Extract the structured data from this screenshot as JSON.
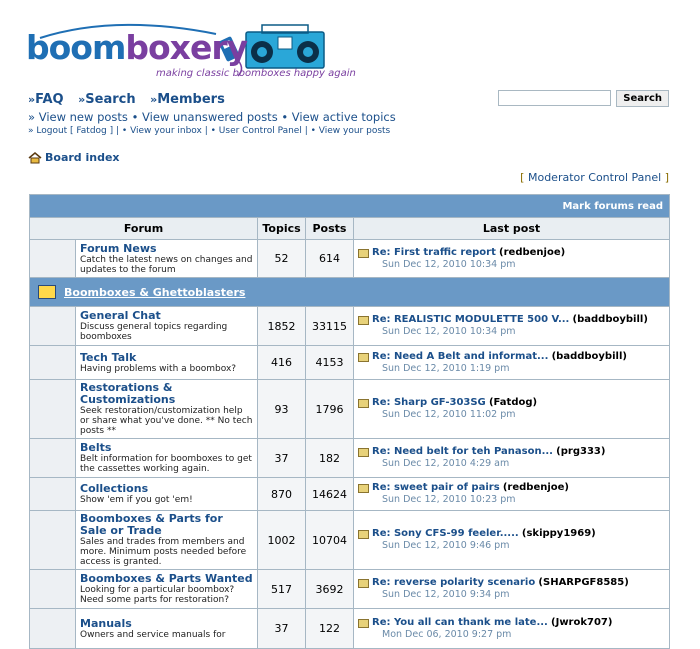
{
  "brand": {
    "name": "boomboxery",
    "tagline": "making classic boomboxes happy again",
    "colors": {
      "blue": "#1f6fb4",
      "purple": "#7a3fa0",
      "boombox": "#2aa7d8"
    }
  },
  "nav": {
    "faq": "FAQ",
    "search": "Search",
    "members": "Members"
  },
  "search": {
    "value": "",
    "button": "Search"
  },
  "subnav": {
    "new_posts": "View new posts",
    "unanswered": "View unanswered posts",
    "active": "View active topics"
  },
  "links": {
    "logout": "Logout [ Fatdog ]",
    "inbox": "View your inbox",
    "ucp": "User Control Panel",
    "your_posts": "View your posts"
  },
  "breadcrumb": {
    "label": "Board index"
  },
  "moderator": {
    "label": "Moderator Control Panel"
  },
  "table": {
    "mark_read": "Mark forums read",
    "headers": {
      "forum": "Forum",
      "topics": "Topics",
      "posts": "Posts",
      "last": "Last post"
    },
    "top_forum": {
      "name": "Forum News",
      "desc": "Catch the latest news on changes and updates to the forum",
      "topics": "52",
      "posts": "614",
      "last_title": "Re: First traffic report",
      "last_by": "(redbenjoe)",
      "last_date": "Sun Dec 12, 2010 10:34 pm"
    },
    "category": "Boomboxes & Ghettoblasters",
    "forums": [
      {
        "name": "General Chat",
        "desc": "Discuss general topics regarding boomboxes",
        "topics": "1852",
        "posts": "33115",
        "last_title": "Re: REALISTIC MODULETTE 500 V...",
        "last_by": "(baddboybill)",
        "last_date": "Sun Dec 12, 2010 10:34 pm"
      },
      {
        "name": "Tech Talk",
        "desc": "Having problems with a boombox?",
        "topics": "416",
        "posts": "4153",
        "last_title": "Re: Need A Belt and informat...",
        "last_by": "(baddboybill)",
        "last_date": "Sun Dec 12, 2010 1:19 pm"
      },
      {
        "name": "Restorations & Customizations",
        "desc": "Seek restoration/customization help or share what you've done. ** No tech posts **",
        "topics": "93",
        "posts": "1796",
        "last_title": "Re: Sharp GF-303SG",
        "last_by": "(Fatdog)",
        "last_date": "Sun Dec 12, 2010 11:02 pm"
      },
      {
        "name": "Belts",
        "desc": "Belt information for boomboxes to get the cassettes working again.",
        "topics": "37",
        "posts": "182",
        "last_title": "Re: Need belt for teh Panason...",
        "last_by": "(prg333)",
        "last_date": "Sun Dec 12, 2010 4:29 am"
      },
      {
        "name": "Collections",
        "desc": "Show 'em if you got 'em!",
        "topics": "870",
        "posts": "14624",
        "last_title": "Re: sweet pair of pairs",
        "last_by": "(redbenjoe)",
        "last_date": "Sun Dec 12, 2010 10:23 pm"
      },
      {
        "name": "Boomboxes & Parts for Sale or Trade",
        "desc": "Sales and trades from members and more. Minimum posts needed before access is granted.",
        "topics": "1002",
        "posts": "10704",
        "last_title": "Re: Sony CFS-99 feeler.....",
        "last_by": "(skippy1969)",
        "last_date": "Sun Dec 12, 2010 9:46 pm"
      },
      {
        "name": "Boomboxes & Parts Wanted",
        "desc": "Looking for a particular boombox? Need some parts for restoration?",
        "topics": "517",
        "posts": "3692",
        "last_title": "Re: reverse polarity scenario",
        "last_by": "(SHARPGF8585)",
        "last_date": "Sun Dec 12, 2010 9:34 pm"
      },
      {
        "name": "Manuals",
        "desc": "Owners and service manuals for",
        "topics": "37",
        "posts": "122",
        "last_title": "Re: You all can thank me late...",
        "last_by": "(Jwrok707)",
        "last_date": "Mon Dec 06, 2010 9:27 pm"
      }
    ]
  }
}
